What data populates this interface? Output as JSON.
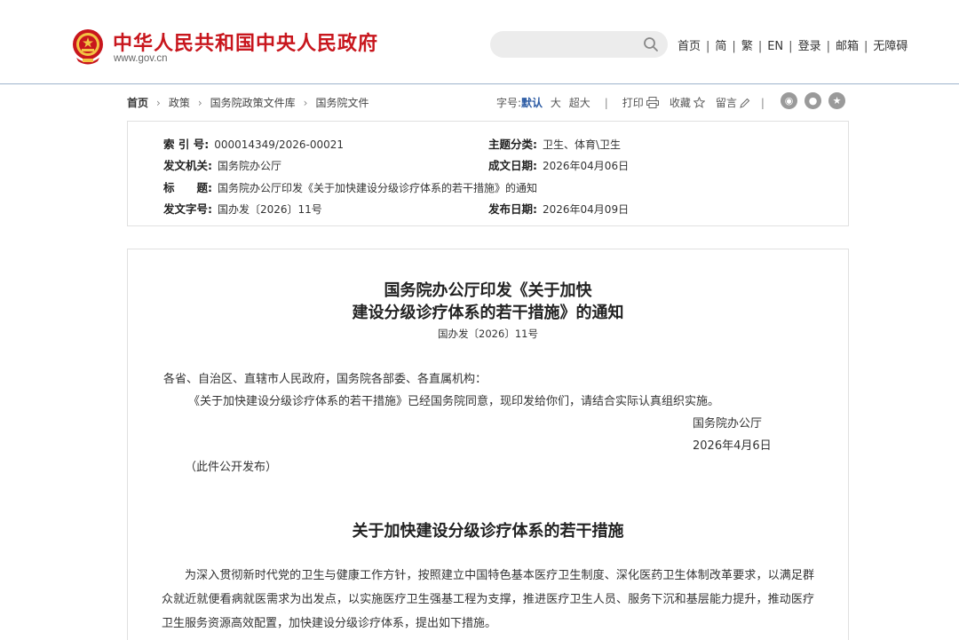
{
  "header": {
    "site_title": "中华人民共和国中央人民政府",
    "site_url": "www.gov.cn",
    "search_placeholder": "",
    "nav": [
      "首页",
      "简",
      "繁",
      "EN",
      "登录",
      "邮箱",
      "无障碍"
    ]
  },
  "breadcrumb": [
    "首页",
    "政策",
    "国务院政策文件库",
    "国务院文件"
  ],
  "tools": {
    "font_size_label": "字号:",
    "font_default": "默认",
    "font_large": "大",
    "font_xlarge": "超大",
    "print": "打印",
    "favorite": "收藏",
    "comment": "留言"
  },
  "meta": {
    "index_label": "索 引 号:",
    "index_value": "000014349/2026-00021",
    "topic_label": "主题分类:",
    "topic_value": "卫生、体育\\卫生",
    "issuer_label": "发文机关:",
    "issuer_value": "国务院办公厅",
    "written_label": "成文日期:",
    "written_value": "2026年04月06日",
    "title_label": "标　　题:",
    "title_value": "国务院办公厅印发《关于加快建设分级诊疗体系的若干措施》的通知",
    "docno_label": "发文字号:",
    "docno_value": "国办发〔2026〕11号",
    "published_label": "发布日期:",
    "published_value": "2026年04月09日"
  },
  "article": {
    "title_line1": "国务院办公厅印发《关于加快",
    "title_line2": "建设分级诊疗体系的若干措施》的通知",
    "doc_number": "国办发〔2026〕11号",
    "addressee": "各省、自治区、直辖市人民政府，国务院各部委、各直属机构：",
    "notice": "《关于加快建设分级诊疗体系的若干措施》已经国务院同意，现印发给你们，请结合实际认真组织实施。",
    "signer": "国务院办公厅",
    "date": "2026年4月6日",
    "public_note": "（此件公开发布）",
    "section_title": "关于加快建设分级诊疗体系的若干措施",
    "intro": "为深入贯彻新时代党的卫生与健康工作方针，按照建立中国特色基本医疗卫生制度、深化医药卫生体制改革要求，以满足群众就近就便看病就医需求为出发点，以实施医疗卫生强基工程为支撑，推进医疗卫生人员、服务下沉和基层能力提升，推动医疗卫生服务资源高效配置，加快建设分级诊疗体系，提出如下措施。"
  },
  "colors": {
    "brand_red": "#c8161d",
    "accent_blue": "#2b5aa3",
    "icon_gray": "#9a9a9a"
  },
  "icons": [
    "national-emblem",
    "search-icon",
    "print-icon",
    "star-icon",
    "pen-icon",
    "weibo-icon",
    "wechat-icon",
    "favorite-star-icon"
  ]
}
